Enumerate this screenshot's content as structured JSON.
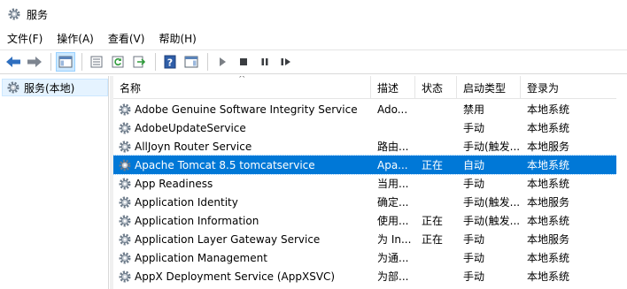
{
  "window": {
    "title": "服务",
    "icon": "gear-icon"
  },
  "menu": [
    {
      "label": "文件(F)"
    },
    {
      "label": "操作(A)"
    },
    {
      "label": "查看(V)"
    },
    {
      "label": "帮助(H)"
    }
  ],
  "toolbar": {
    "buttons": [
      "back-icon",
      "forward-icon",
      "show-hide-tree-icon",
      "properties-icon",
      "refresh-icon",
      "export-icon",
      "help-icon",
      "action-pane-icon",
      "start-service-icon",
      "stop-service-icon",
      "pause-service-icon",
      "restart-service-icon"
    ]
  },
  "tree": {
    "root_label": "服务(本地)"
  },
  "table": {
    "columns": {
      "name": "名称",
      "desc": "描述",
      "status": "状态",
      "start": "启动类型",
      "logon": "登录为"
    },
    "rows": [
      {
        "name": "Adobe Genuine Software Integrity Service",
        "desc": "Ado...",
        "status": "",
        "start": "禁用",
        "logon": "本地系统"
      },
      {
        "name": "AdobeUpdateService",
        "desc": "",
        "status": "",
        "start": "手动",
        "logon": "本地系统"
      },
      {
        "name": "AllJoyn Router Service",
        "desc": "路由...",
        "status": "",
        "start": "手动(触发...",
        "logon": "本地服务"
      },
      {
        "name": "Apache Tomcat 8.5 tomcatservice",
        "desc": "Apa...",
        "status": "正在",
        "start": "自动",
        "logon": "本地系统",
        "selected": true
      },
      {
        "name": "App Readiness",
        "desc": "当用...",
        "status": "",
        "start": "手动",
        "logon": "本地系统"
      },
      {
        "name": "Application Identity",
        "desc": "确定...",
        "status": "",
        "start": "手动(触发...",
        "logon": "本地服务"
      },
      {
        "name": "Application Information",
        "desc": "使用...",
        "status": "正在",
        "start": "手动(触发...",
        "logon": "本地系统"
      },
      {
        "name": "Application Layer Gateway Service",
        "desc": "为 In...",
        "status": "正在",
        "start": "手动",
        "logon": "本地服务"
      },
      {
        "name": "Application Management",
        "desc": "为通...",
        "status": "",
        "start": "手动",
        "logon": "本地系统"
      },
      {
        "name": "AppX Deployment Service (AppXSVC)",
        "desc": "为部...",
        "status": "",
        "start": "手动",
        "logon": "本地系统"
      }
    ]
  },
  "colors": {
    "selection": "#0078d7",
    "hover": "#e5f3ff"
  }
}
